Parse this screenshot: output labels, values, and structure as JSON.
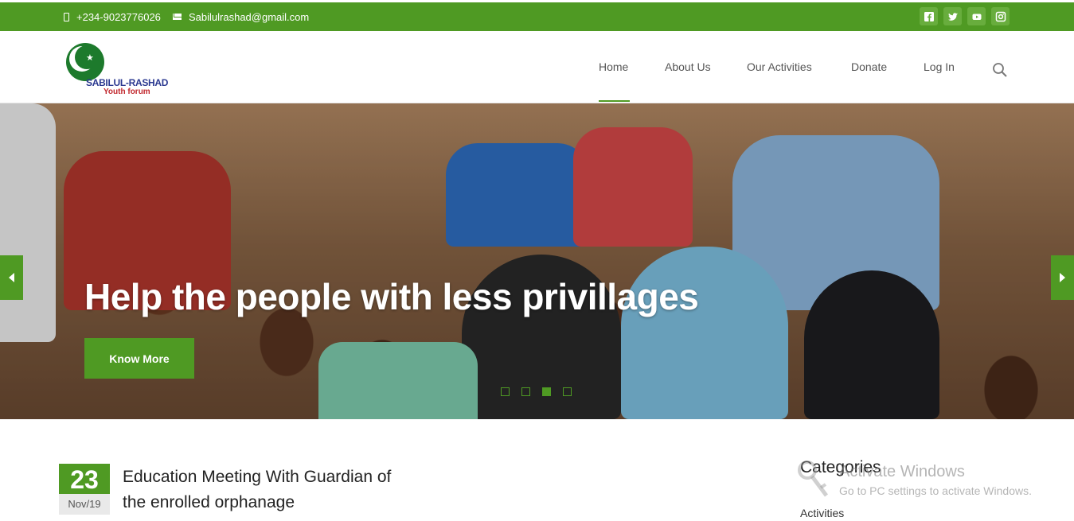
{
  "topbar": {
    "phone": "+234-9023776026",
    "email": "Sabilulrashad@gmail.com",
    "social": [
      "facebook-icon",
      "twitter-icon",
      "youtube-icon",
      "instagram-icon"
    ],
    "color": "#4f9a23"
  },
  "logo": {
    "name": "SABILUL-RASHAD",
    "tagline": "Youth forum"
  },
  "nav": {
    "items": [
      {
        "label": "Home",
        "active": true
      },
      {
        "label": "About Us"
      },
      {
        "label": "Our Activities"
      },
      {
        "label": "Donate"
      },
      {
        "label": "Log In"
      }
    ],
    "search_icon": "search-icon"
  },
  "hero": {
    "headline": "Help the people with less privillages",
    "button": "Know More",
    "slides": 4,
    "active_slide": 3
  },
  "post": {
    "day": "23",
    "month": "Nov/19",
    "title": "Education Meeting With Guardian of the enrolled orphanage"
  },
  "sidebar": {
    "title": "Categories",
    "items": [
      "Activities"
    ]
  },
  "watermark": {
    "line1": "Activate Windows",
    "line2": "Go to PC settings to activate Windows."
  }
}
